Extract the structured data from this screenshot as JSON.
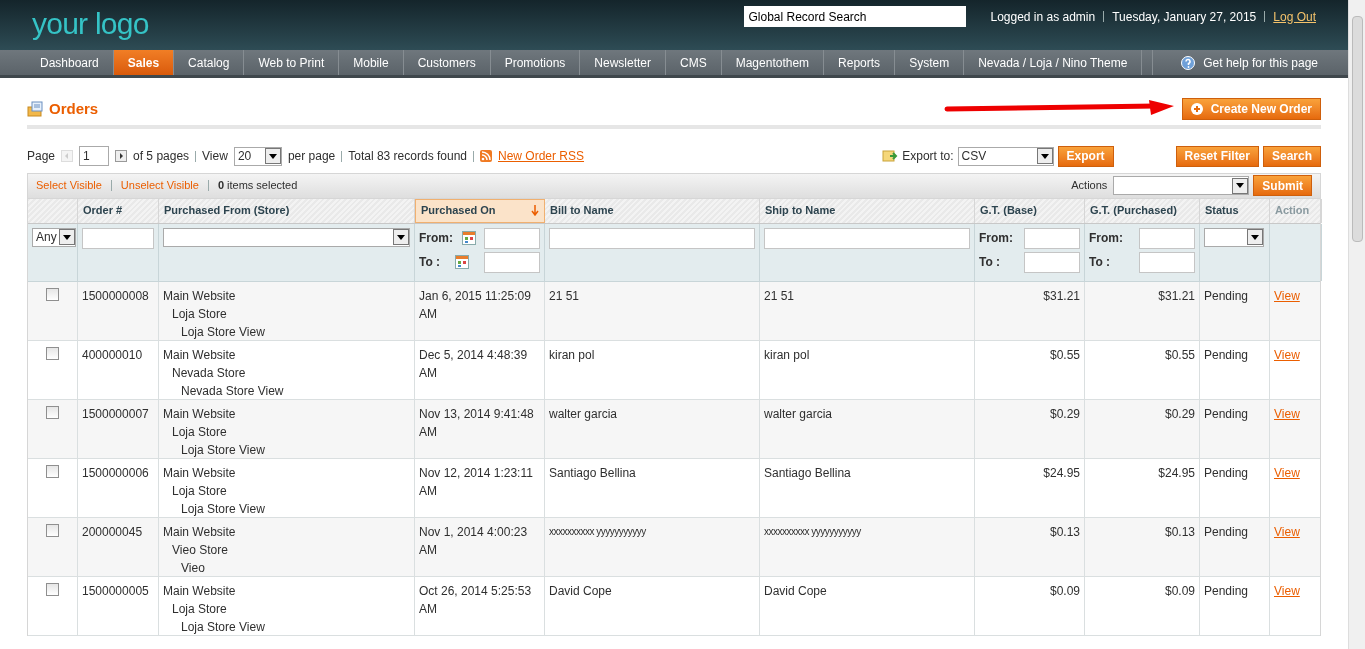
{
  "header": {
    "logo": "your logo",
    "search_value": "Global Record Search",
    "user": "Logged in as admin",
    "date": "Tuesday, January 27, 2015",
    "logout": "Log Out"
  },
  "nav": {
    "items": [
      {
        "label": "Dashboard",
        "selected": false
      },
      {
        "label": "Sales",
        "selected": true
      },
      {
        "label": "Catalog",
        "selected": false
      },
      {
        "label": "Web to Print",
        "selected": false
      },
      {
        "label": "Mobile",
        "selected": false
      },
      {
        "label": "Customers",
        "selected": false
      },
      {
        "label": "Promotions",
        "selected": false
      },
      {
        "label": "Newsletter",
        "selected": false
      },
      {
        "label": "CMS",
        "selected": false
      },
      {
        "label": "Magentothem",
        "selected": false
      },
      {
        "label": "Reports",
        "selected": false
      },
      {
        "label": "System",
        "selected": false
      },
      {
        "label": "Nevada / Loja / Nino Theme",
        "selected": false
      }
    ],
    "help": "Get help for this page"
  },
  "title": "Orders",
  "create_button": "Create New Order",
  "pager": {
    "page_label": "Page",
    "page": "1",
    "of_pages": "of 5 pages",
    "view_label": "View",
    "per_page": "20",
    "per_page_label": "per page",
    "total": "Total 83 records found",
    "rss": "New Order RSS"
  },
  "export": {
    "label": "Export to:",
    "format": "CSV",
    "button": "Export"
  },
  "reset_filter": "Reset Filter",
  "search": "Search",
  "massaction": {
    "select_visible": "Select Visible",
    "unselect_visible": "Unselect Visible",
    "count": "0",
    "count_label": "items selected",
    "actions_label": "Actions",
    "submit": "Submit"
  },
  "table": {
    "columns": [
      {
        "sorted": false
      },
      {
        "label": "Order #",
        "sorted": false,
        "sortable": true
      },
      {
        "label": "Purchased From (Store)",
        "sorted": false,
        "sortable": true
      },
      {
        "label": "Purchased On",
        "sorted": true,
        "sortable": true
      },
      {
        "label": "Bill to Name",
        "sorted": false,
        "sortable": true
      },
      {
        "label": "Ship to Name",
        "sorted": false,
        "sortable": true
      },
      {
        "label": "G.T. (Base)",
        "sorted": false,
        "sortable": true
      },
      {
        "label": "G.T. (Purchased)",
        "sorted": false,
        "sortable": true
      },
      {
        "label": "Status",
        "sorted": false,
        "sortable": true
      },
      {
        "label": "Action",
        "sorted": false,
        "sortable": false
      }
    ],
    "filters": [
      {
        "kind": "select_small",
        "value": "Any"
      },
      {
        "kind": "text"
      },
      {
        "kind": "select"
      },
      {
        "kind": "date",
        "from": "From:",
        "to": "To :"
      },
      {
        "kind": "text"
      },
      {
        "kind": "text"
      },
      {
        "kind": "range",
        "from": "From:",
        "to": "To :"
      },
      {
        "kind": "range",
        "from": "From:",
        "to": "To :"
      },
      {
        "kind": "select_small"
      },
      {
        "kind": "none"
      }
    ],
    "rows": [
      {
        "checked": false,
        "order": "1500000008",
        "store": {
          "name": "Main Website",
          "children": [
            {
              "name": "Loja Store",
              "children": [
                {
                  "name": "Loja Store View"
                }
              ]
            }
          ]
        },
        "date": "Jan 6, 2015 11:25:09 AM",
        "bill": "21 51",
        "ship": "21 51",
        "base": "$31.21",
        "purchased": "$31.21",
        "status": "Pending",
        "action": "View"
      },
      {
        "checked": false,
        "order": "400000010",
        "store": {
          "name": "Main Website",
          "children": [
            {
              "name": "Nevada Store",
              "children": [
                {
                  "name": "Nevada Store View"
                }
              ]
            }
          ]
        },
        "date": "Dec 5, 2014 4:48:39 AM",
        "bill": "kiran pol",
        "ship": "kiran pol",
        "base": "$0.55",
        "purchased": "$0.55",
        "status": "Pending",
        "action": "View"
      },
      {
        "checked": false,
        "order": "1500000007",
        "store": {
          "name": "Main Website",
          "children": [
            {
              "name": "Loja Store",
              "children": [
                {
                  "name": "Loja Store View"
                }
              ]
            }
          ]
        },
        "date": "Nov 13, 2014 9:41:48 AM",
        "bill": "walter garcia",
        "ship": "walter garcia",
        "base": "$0.29",
        "purchased": "$0.29",
        "status": "Pending",
        "action": "View"
      },
      {
        "checked": false,
        "order": "1500000006",
        "store": {
          "name": "Main Website",
          "children": [
            {
              "name": "Loja Store",
              "children": [
                {
                  "name": "Loja Store View"
                }
              ]
            }
          ]
        },
        "date": "Nov 12, 2014 1:23:11 AM",
        "bill": "Santiago Bellina",
        "ship": "Santiago Bellina",
        "base": "$24.95",
        "purchased": "$24.95",
        "status": "Pending",
        "action": "View"
      },
      {
        "checked": false,
        "order": "200000045",
        "store": {
          "name": "Main Website",
          "children": [
            {
              "name": "Vieo Store",
              "children": [
                {
                  "name": "Vieo"
                }
              ]
            }
          ]
        },
        "date": "Nov 1, 2014 4:00:23 AM",
        "bill": "xxxxxxxxxx yyyyyyyyyyy",
        "ship": "xxxxxxxxxx yyyyyyyyyyy",
        "base": "$0.13",
        "purchased": "$0.13",
        "status": "Pending",
        "action": "View"
      },
      {
        "checked": false,
        "order": "1500000005",
        "store": {
          "name": "Main Website",
          "children": [
            {
              "name": "Loja Store",
              "children": [
                {
                  "name": "Loja Store View"
                }
              ]
            }
          ]
        },
        "date": "Oct 26, 2014 5:25:53 AM",
        "bill": "David Cope",
        "ship": "David Cope",
        "base": "$0.09",
        "purchased": "$0.09",
        "status": "Pending",
        "action": "View"
      }
    ]
  }
}
